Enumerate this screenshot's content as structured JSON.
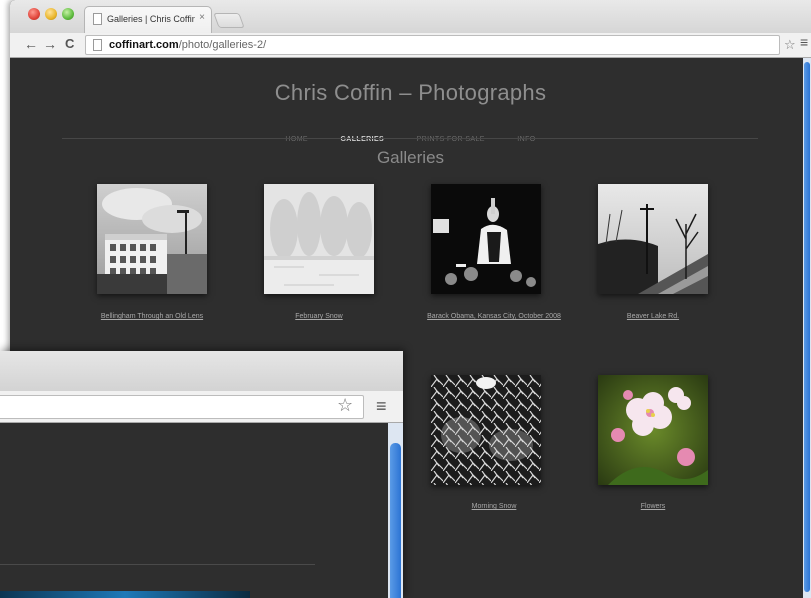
{
  "browser": {
    "tab_title": "Galleries | Chris Coffin – P",
    "tab_close": "×",
    "url_domain": "coffinart.com",
    "url_path": "/photo/galleries-2/",
    "back_glyph": "←",
    "forward_glyph": "→",
    "reload_glyph": "C",
    "star_glyph": "☆",
    "menu_glyph": "≡"
  },
  "site": {
    "title": "Chris Coffin – Photographs",
    "nav": [
      "HOME",
      "GALLERIES",
      "PRINTS FOR SALE",
      "INFO"
    ],
    "active_nav": "GALLERIES",
    "heading": "Galleries"
  },
  "galleries": [
    {
      "caption": "Bellingham Through an Old Lens"
    },
    {
      "caption": "February Snow"
    },
    {
      "caption": "Barack Obama, Kansas City, October 2008"
    },
    {
      "caption": "Beaver Lake Rd."
    },
    {
      "caption": "Morning Snow"
    },
    {
      "caption": "Flowers"
    }
  ],
  "second_window": {
    "star_glyph": "☆",
    "menu_glyph": "≡"
  },
  "colors": {
    "page_bg": "#2e2e2e",
    "scroll_accent": "#2c74d4"
  },
  "icons": [
    "close-window-icon",
    "minimize-window-icon",
    "zoom-window-icon",
    "document-icon",
    "back-arrow-icon",
    "forward-arrow-icon",
    "reload-icon",
    "bookmark-star-icon",
    "menu-icon"
  ]
}
